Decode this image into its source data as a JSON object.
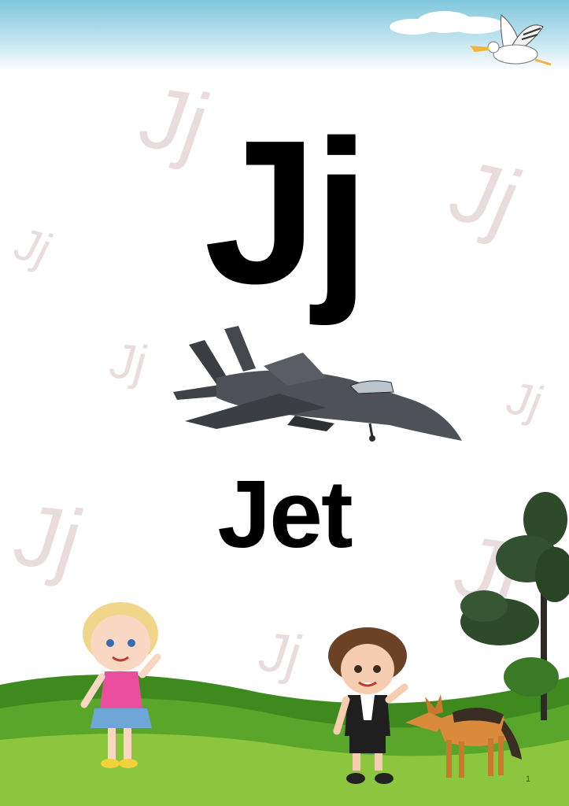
{
  "letter": "Jj",
  "word": "Jet",
  "watermark_text": "Jj",
  "page_number": "1",
  "icons": [
    "bird-icon",
    "jet-icon",
    "tree-icon",
    "girl-icon",
    "boy-icon",
    "jackal-icon",
    "cloud-icon"
  ],
  "colors": {
    "sky": "#7fc6dc",
    "grass": "#5aa62a",
    "watermark": "#e8dcdc",
    "text": "#000000"
  }
}
